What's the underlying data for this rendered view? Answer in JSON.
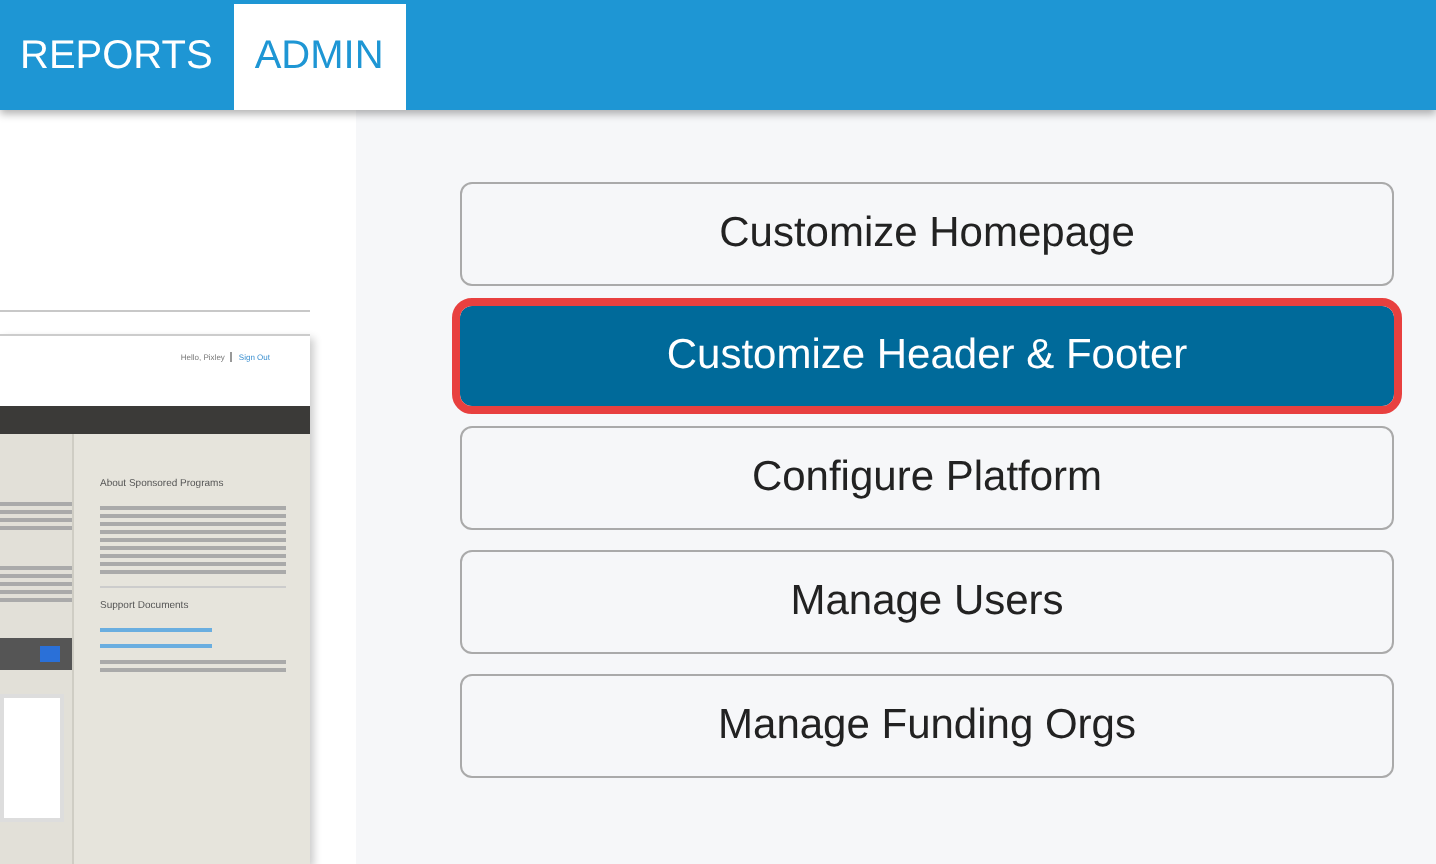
{
  "nav": {
    "tabs": [
      {
        "label": "REPORTS",
        "selected": false
      },
      {
        "label": "ADMIN",
        "selected": true
      }
    ]
  },
  "preview": {
    "greeting": "Hello, Pixley",
    "sign_out": "Sign Out",
    "sidebar_heading": "About Sponsored Programs",
    "docs_heading": "Support Documents"
  },
  "actions": [
    {
      "label": "Customize Homepage",
      "selected": false
    },
    {
      "label": "Customize Header & Footer",
      "selected": true
    },
    {
      "label": "Configure Platform",
      "selected": false
    },
    {
      "label": "Manage Users",
      "selected": false
    },
    {
      "label": "Manage Funding Orgs",
      "selected": false
    }
  ]
}
